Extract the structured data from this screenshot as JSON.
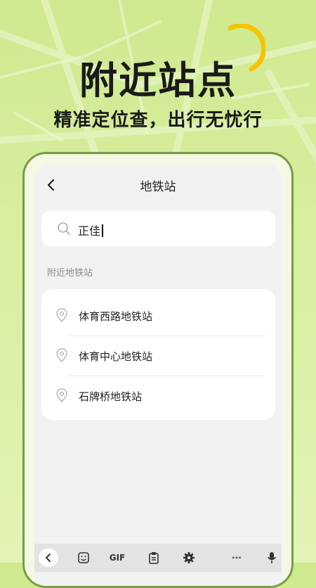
{
  "promo": {
    "headline": "附近站点",
    "subheadline": "精准定位查，出行无忧行"
  },
  "app": {
    "nav_title": "地铁站",
    "search": {
      "value": "正佳"
    },
    "section_label": "附近地铁站",
    "stations": [
      {
        "name": "体育西路地铁站"
      },
      {
        "name": "体育中心地铁站"
      },
      {
        "name": "石牌桥地铁站"
      }
    ]
  },
  "keyboard": {
    "gif_label": "GIF",
    "more_label": "···"
  },
  "colors": {
    "background": "#d7ee9e",
    "accent_arc": "#f5c400",
    "phone_border": "#7a9a45"
  },
  "icons": [
    "back-arrow-icon",
    "search-icon",
    "location-pin-icon",
    "keyboard-collapse-icon",
    "emoji-icon",
    "clipboard-icon",
    "gear-icon",
    "microphone-icon"
  ]
}
